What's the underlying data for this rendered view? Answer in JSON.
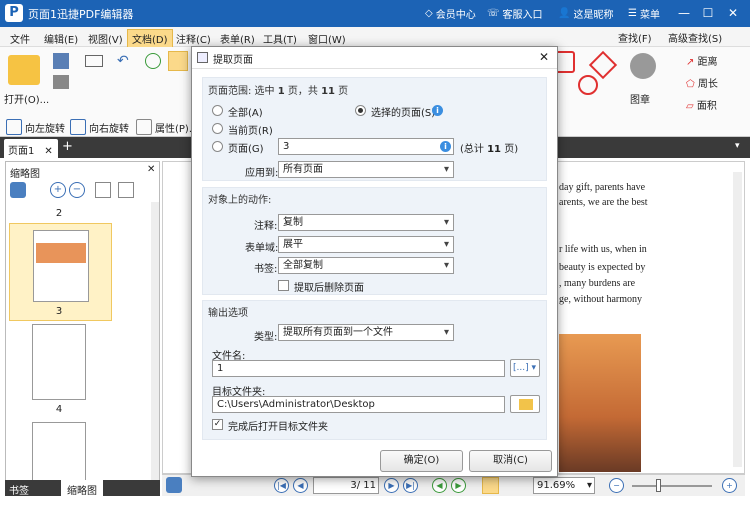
{
  "app": {
    "title": "页面1迅捷PDF编辑器",
    "logo_letter": "P",
    "member": "会员中心",
    "service": "客服入口",
    "nickname": "这是昵称",
    "menu": "菜单"
  },
  "menubar": [
    "文件",
    "编辑(E)",
    "视图(V)",
    "文档(D)",
    "注释(C)",
    "表单(R)",
    "工具(T)",
    "窗口(W)"
  ],
  "ribbon": {
    "open": "打开(O)...",
    "rotate_left": "向左旋转",
    "rotate_right": "向右旋转",
    "properties": "属性(P)...",
    "find": "查找(F)",
    "adv_find": "高级查找(S)",
    "stamp": "图章",
    "distance": "距离",
    "perimeter": "周长",
    "area": "面积"
  },
  "doc_tab": "页面1",
  "thumbnail_panel": {
    "title": "缩略图",
    "pages": [
      "2",
      "3",
      "4"
    ]
  },
  "bottom_tabs": [
    "书签",
    "缩略图"
  ],
  "doc_text": [
    "day gift, parents have",
    "arents, we are the best",
    "r life with us, when in",
    "beauty is expected by",
    ", many burdens are",
    "ge, without harmony"
  ],
  "status": {
    "page_field": "3",
    "page_total": "/ 11",
    "zoom": "91.69%"
  },
  "dialog": {
    "title": "提取页面",
    "range_header_prefix": "页面范围: 选中 ",
    "range_selected": "1",
    "range_header_mid": " 页，共 ",
    "range_total": "11",
    "range_header_suffix": " 页",
    "all": "全部(A)",
    "selected_pages": "选择的页面(S)",
    "current_page": "当前页(R)",
    "pages": "页面(G)",
    "pages_value": "3",
    "total_prefix": "(总计 ",
    "total_value": "11",
    "total_suffix": " 页)",
    "apply_to_label": "应用到:",
    "apply_to_value": "所有页面",
    "actions_header": "对象上的动作:",
    "comment_label": "注释:",
    "comment_value": "复制",
    "form_label": "表单域:",
    "form_value": "展平",
    "bookmark_label": "书签:",
    "bookmark_value": "全部复制",
    "delete_after": "提取后删除页面",
    "output_header": "输出选项",
    "type_label": "类型:",
    "type_value": "提取所有页面到一个文件",
    "filename_label": "文件名:",
    "filename_value": "1",
    "filename_macro": "[...]",
    "target_label": "目标文件夹:",
    "target_value": "C:\\Users\\Administrator\\Desktop",
    "open_after": "完成后打开目标文件夹",
    "ok": "确定(O)",
    "cancel": "取消(C)"
  },
  "colors": {
    "titlebar": "#1c63b5",
    "accent": "#fbd98a",
    "selection": "#fff2c6"
  }
}
